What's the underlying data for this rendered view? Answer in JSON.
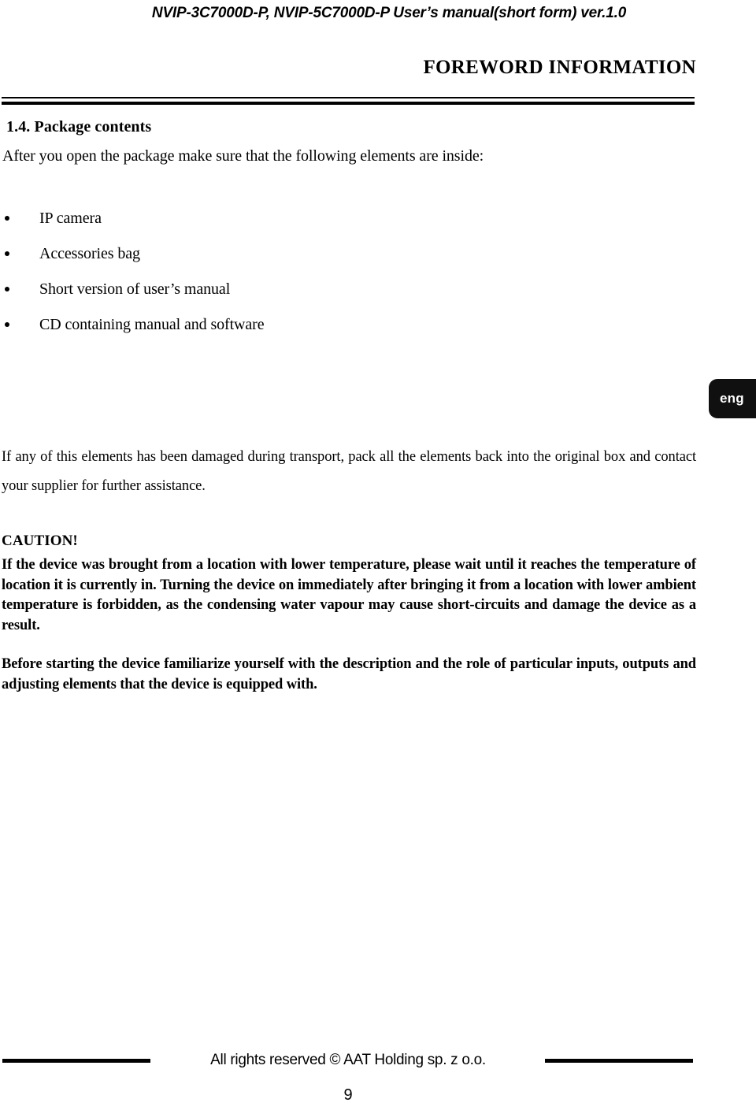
{
  "header": {
    "running_title": "NVIP-3C7000D-P, NVIP-5C7000D-P User’s manual(short form) ver.1.0",
    "chapter_title": "FOREWORD INFORMATION"
  },
  "section": {
    "number_and_title": "1.4. Package contents",
    "intro": "After you open the package make sure that the following elements are inside:",
    "items": [
      {
        "label": "IP camera"
      },
      {
        "label": "Accessories bag"
      },
      {
        "label": "Short version of user’s manual"
      },
      {
        "label": "CD containing manual and software"
      }
    ]
  },
  "language_tab": {
    "label": "eng",
    "color": "#101010",
    "text_color": "#ffffff"
  },
  "body": {
    "damage_note": "If any of this elements has been damaged during transport, pack all the elements back into the original box and contact your supplier for further assistance.",
    "caution_label": "CAUTION!",
    "caution_body": "If the device was brought from a location with lower temperature, please wait until it reaches the temperature of location it is currently in. Turning the device on immediately after bringing it from a location with lower ambient temperature is forbidden, as the condensing water vapour may cause short-circuits and damage the device as a result.",
    "before_start": "Before starting the device familiarize yourself with the description and the role of particular inputs, outputs and adjusting elements that the device is equipped with."
  },
  "footer": {
    "copyright": "All rights reserved © AAT Holding sp. z o.o.",
    "page_number": "9"
  }
}
